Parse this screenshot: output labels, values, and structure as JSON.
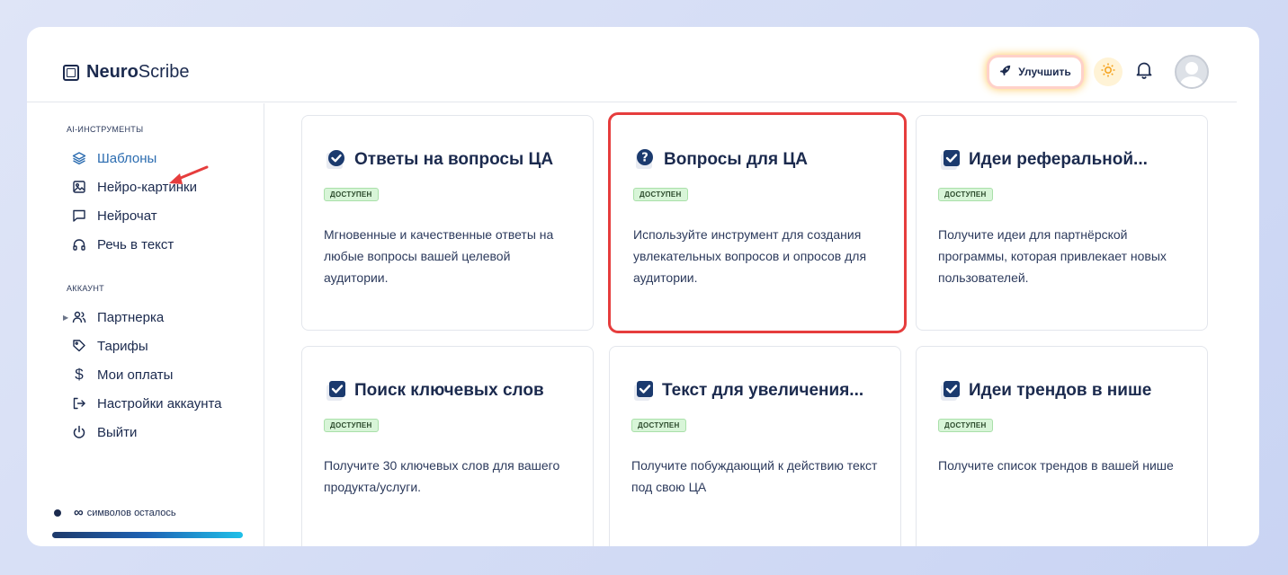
{
  "app": {
    "brand_bold": "Neuro",
    "brand_regular": "Scribe"
  },
  "header": {
    "upgrade_label": "Улучшить"
  },
  "sidebar": {
    "section_ai": "AI-ИНСТРУМЕНТЫ",
    "ai_items": [
      {
        "label": "Шаблоны",
        "icon": "layers-icon"
      },
      {
        "label": "Нейро-картинки",
        "icon": "image-icon"
      },
      {
        "label": "Нейрочат",
        "icon": "chat-icon"
      },
      {
        "label": "Речь в текст",
        "icon": "headphones-icon"
      }
    ],
    "section_account": "АККАУНТ",
    "account_items": [
      {
        "label": "Партнерка",
        "icon": "users-icon"
      },
      {
        "label": "Тарифы",
        "icon": "tag-icon"
      },
      {
        "label": "Мои оплаты",
        "icon": "dollar-icon"
      },
      {
        "label": "Настройки аккаунта",
        "icon": "logout-icon"
      },
      {
        "label": "Выйти",
        "icon": "power-icon"
      }
    ],
    "chars_infinity": "∞",
    "chars_label": "символов осталось"
  },
  "cards": [
    {
      "title": "Ответы на вопросы ЦА",
      "badge": "ДОСТУПЕН",
      "description": "Мгновенные и качественные ответы на любые вопросы вашей целевой аудитории.",
      "icon": "check-circle-icon"
    },
    {
      "title": "Вопросы для ЦА",
      "badge": "ДОСТУПЕН",
      "description": "Используйте инструмент для создания увлекательных вопросов и опросов для аудитории.",
      "icon": "question-circle-icon"
    },
    {
      "title": "Идеи реферальной...",
      "badge": "ДОСТУПЕН",
      "description": "Получите идеи для партнёрской программы, которая привлекает новых пользователей.",
      "icon": "check-square-icon"
    },
    {
      "title": "Поиск ключевых слов",
      "badge": "ДОСТУПЕН",
      "description": "Получите 30 ключевых слов для вашего продукта/услуги.",
      "icon": "check-square-icon"
    },
    {
      "title": "Текст для увеличения...",
      "badge": "ДОСТУПЕН",
      "description": "Получите побуждающий к действию текст под свою ЦА",
      "icon": "check-square-icon"
    },
    {
      "title": "Идеи трендов в нише",
      "badge": "ДОСТУПЕН",
      "description": "Получите список трендов в вашей нише",
      "icon": "check-square-icon"
    }
  ],
  "colors": {
    "accent": "#2b6cb0",
    "navy": "#1b2a4e",
    "highlight": "#e63d3d",
    "badge_bg": "#d8f5d8"
  }
}
